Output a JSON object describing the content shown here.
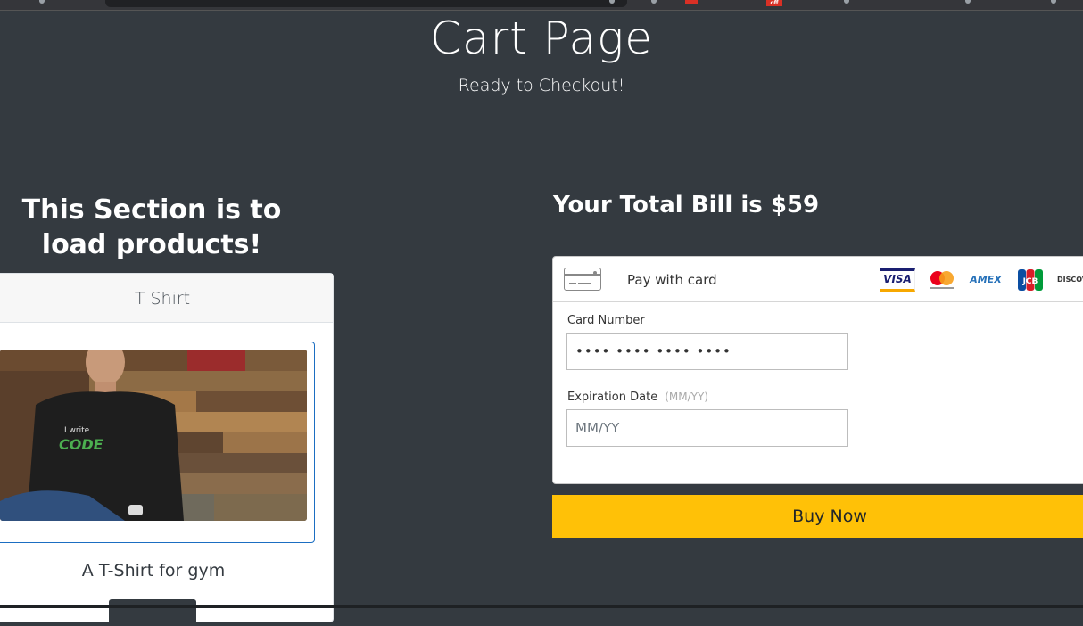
{
  "header": {
    "title": "Cart Page",
    "subtitle": "Ready to Checkout!"
  },
  "products": {
    "heading": "This Section is to load products!",
    "card": {
      "name": "T Shirt",
      "image_text_small": "I write",
      "image_text_large": "CODE",
      "description": "A T-Shirt for gym"
    }
  },
  "bill": {
    "heading": "Your Total Bill is $59"
  },
  "payment": {
    "pay_with_label": "Pay with card",
    "brands": {
      "visa": "VISA",
      "amex": "AMEX",
      "discover": "DISCOVER"
    },
    "card_number": {
      "label": "Card Number",
      "value": "•••• •••• •••• ••••"
    },
    "expiration": {
      "label": "Expiration Date",
      "hint": "(MM/YY)",
      "placeholder": "MM/YY"
    },
    "buy_label": "Buy Now"
  },
  "colors": {
    "background": "#343a40",
    "accent": "#ffc107",
    "frame_border": "#1b6ec2"
  }
}
